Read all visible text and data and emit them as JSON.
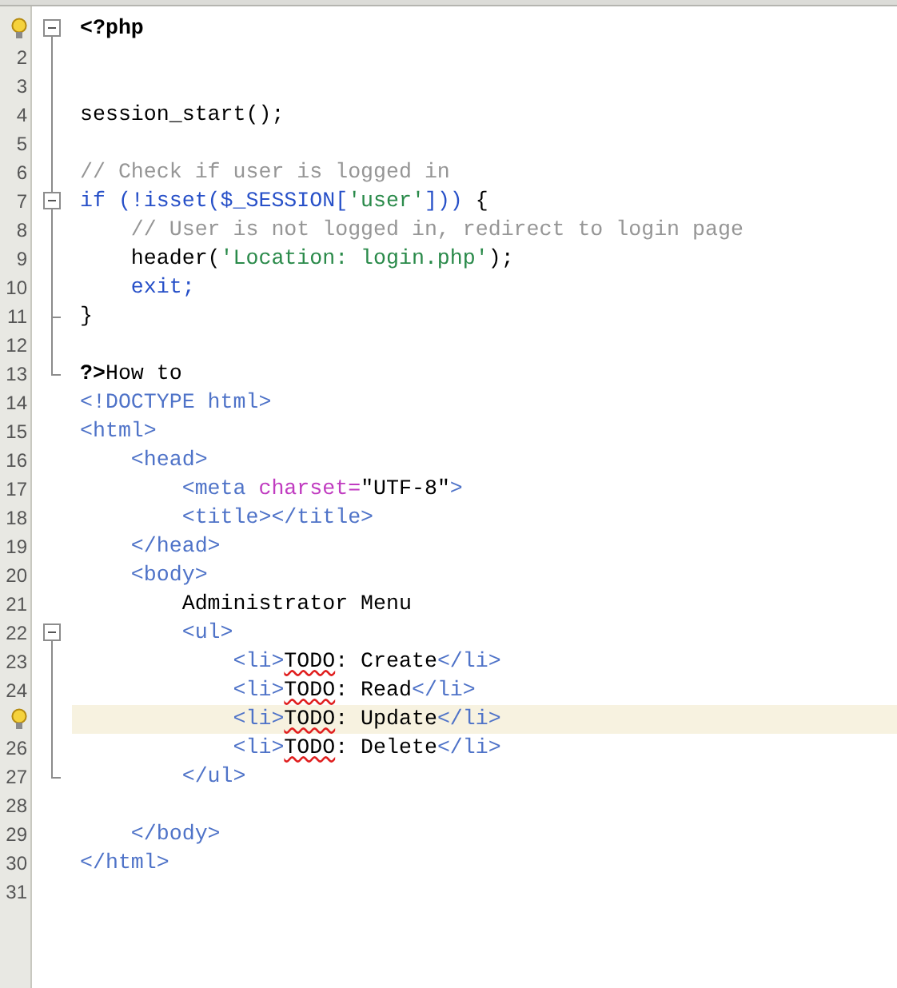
{
  "editor": {
    "lines": [
      {
        "hint": true,
        "current": false,
        "expanded": true,
        "tokens": [
          {
            "kind": "delim",
            "text": "<?php"
          }
        ]
      },
      {
        "number": "2",
        "hint": false,
        "current": false
      },
      {
        "number": "3",
        "hint": false,
        "current": false
      },
      {
        "number": "4",
        "hint": false,
        "current": false,
        "tokens": [
          {
            "kind": "plain",
            "text": "session_start();"
          }
        ]
      },
      {
        "number": "5",
        "hint": false,
        "current": false
      },
      {
        "number": "6",
        "hint": false,
        "current": false,
        "tokens": [
          {
            "kind": "comment",
            "text": "// Check if user is logged in"
          }
        ]
      },
      {
        "number": "7",
        "hint": false,
        "current": false,
        "expanded": true,
        "tokens": [
          {
            "kind": "keyword",
            "text": "if (!isset($_SESSION["
          },
          {
            "kind": "string",
            "text": "'user'"
          },
          {
            "kind": "keyword",
            "text": "]))"
          },
          {
            "kind": "plain",
            "text": " {"
          }
        ]
      },
      {
        "number": "8",
        "hint": false,
        "current": false,
        "tokens": [
          {
            "kind": "comment",
            "text": "    // User is not logged in, redirect to login page"
          }
        ]
      },
      {
        "number": "9",
        "hint": false,
        "current": false,
        "tokens": [
          {
            "kind": "plain",
            "text": "    header("
          },
          {
            "kind": "string",
            "text": "'Location: login.php'"
          },
          {
            "kind": "plain",
            "text": ");"
          }
        ]
      },
      {
        "number": "10",
        "hint": false,
        "current": false,
        "tokens": [
          {
            "kind": "keyword",
            "text": "    exit;"
          }
        ]
      },
      {
        "number": "11",
        "hint": false,
        "current": false,
        "fold_end": true,
        "tokens": [
          {
            "kind": "plain",
            "text": "}"
          }
        ]
      },
      {
        "number": "12",
        "hint": false,
        "current": false
      },
      {
        "number": "13",
        "hint": false,
        "current": false,
        "fold_end": true,
        "tokens": [
          {
            "kind": "delim",
            "text": "?>"
          },
          {
            "kind": "plain",
            "text": "How to"
          }
        ]
      },
      {
        "number": "14",
        "hint": false,
        "current": false,
        "tokens": [
          {
            "kind": "tag",
            "text": "<!DOCTYPE html>"
          }
        ]
      },
      {
        "number": "15",
        "hint": false,
        "current": false,
        "tokens": [
          {
            "kind": "tag",
            "text": "<html>"
          }
        ]
      },
      {
        "number": "16",
        "hint": false,
        "current": false,
        "tokens": [
          {
            "kind": "tag",
            "text": "    <head>"
          }
        ]
      },
      {
        "number": "17",
        "hint": false,
        "current": false,
        "tokens": [
          {
            "kind": "tag",
            "text": "        <meta "
          },
          {
            "kind": "attr",
            "text": "charset="
          },
          {
            "kind": "plain",
            "text": "\"UTF-8\""
          },
          {
            "kind": "tag",
            "text": ">"
          }
        ]
      },
      {
        "number": "18",
        "hint": false,
        "current": false,
        "tokens": [
          {
            "kind": "tag",
            "text": "        <title></title>"
          }
        ]
      },
      {
        "number": "19",
        "hint": false,
        "current": false,
        "tokens": [
          {
            "kind": "tag",
            "text": "    </head>"
          }
        ]
      },
      {
        "number": "20",
        "hint": false,
        "current": false,
        "tokens": [
          {
            "kind": "tag",
            "text": "    <body>"
          }
        ]
      },
      {
        "number": "21",
        "hint": false,
        "current": false,
        "tokens": [
          {
            "kind": "plain",
            "text": "        Administrator Menu"
          }
        ]
      },
      {
        "number": "22",
        "hint": false,
        "current": false,
        "expanded": true,
        "tokens": [
          {
            "kind": "tag",
            "text": "        <ul>"
          }
        ]
      },
      {
        "number": "23",
        "hint": false,
        "current": false,
        "tokens": [
          {
            "kind": "tag",
            "text": "            <li>"
          },
          {
            "kind": "todo",
            "text": "TODO"
          },
          {
            "kind": "plain",
            "text": ": Create"
          },
          {
            "kind": "tag",
            "text": "</li>"
          }
        ]
      },
      {
        "number": "24",
        "hint": false,
        "current": false,
        "tokens": [
          {
            "kind": "tag",
            "text": "            <li>"
          },
          {
            "kind": "todo",
            "text": "TODO"
          },
          {
            "kind": "plain",
            "text": ": Read"
          },
          {
            "kind": "tag",
            "text": "</li>"
          }
        ]
      },
      {
        "hint": true,
        "current": true,
        "tokens": [
          {
            "kind": "tag",
            "text": "            <li>"
          },
          {
            "kind": "todo",
            "text": "TODO"
          },
          {
            "kind": "plain",
            "text": ": Update"
          },
          {
            "kind": "tag",
            "text": "</li>"
          }
        ]
      },
      {
        "number": "26",
        "hint": false,
        "current": false,
        "tokens": [
          {
            "kind": "tag",
            "text": "            <li>"
          },
          {
            "kind": "todo",
            "text": "TODO"
          },
          {
            "kind": "plain",
            "text": ": Delete"
          },
          {
            "kind": "tag",
            "text": "</li>"
          }
        ]
      },
      {
        "number": "27",
        "hint": false,
        "current": false,
        "fold_end": true,
        "tokens": [
          {
            "kind": "tag",
            "text": "        </ul>"
          }
        ]
      },
      {
        "number": "28",
        "hint": false,
        "current": false
      },
      {
        "number": "29",
        "hint": false,
        "current": false,
        "tokens": [
          {
            "kind": "tag",
            "text": "    </body>"
          }
        ]
      },
      {
        "number": "30",
        "hint": false,
        "current": false,
        "tokens": [
          {
            "kind": "tag",
            "text": "</html>"
          }
        ]
      },
      {
        "number": "31",
        "hint": false,
        "current": false
      }
    ]
  }
}
